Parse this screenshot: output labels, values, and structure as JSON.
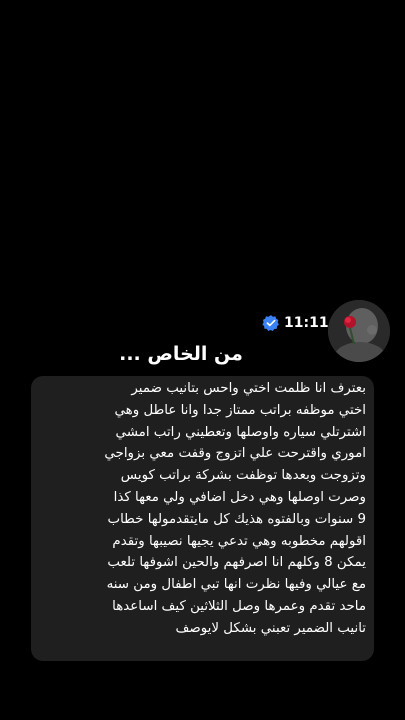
{
  "status": {
    "time": "11:11",
    "verified_icon": "verified-badge-icon",
    "verified_color": "#3b82f6"
  },
  "header": {
    "title": "من الخاص ..."
  },
  "message": {
    "lines": [
      "بعترف انا ظلمت اختي واحس بتانيب ضمير",
      "اختي موظفه براتب ممتاز جدا وانا عاطل وهي",
      "اشترتلي سياره واوصلها وتعطيني راتب امشي",
      "اموري واقترحت علي اتزوج وقفت معي بزواجي",
      "وتزوجت وبعدها توظفت بشركة براتب كويس",
      "وصرت اوصلها وهي دخل اضافي ولي معها كذا",
      "9 سنوات وبالفتوه هذيك كل مايتقدمولها خطاب",
      "اقولهم مخطوبه وهي تدعي يجيها نصيبها وتقدم",
      "يمكن 8 وكلهم انا اصرفهم والحين اشوفها تلعب",
      "مع عيالي وفيها نظرت انها تبي اطفال ومن سنه",
      "ماحد تقدم وعمرها وصل الثلاثين كيف اساعدها",
      "تانيب الضمير تعبني بشكل لايوصف"
    ],
    "bubble_color": "#1f1f1f"
  }
}
